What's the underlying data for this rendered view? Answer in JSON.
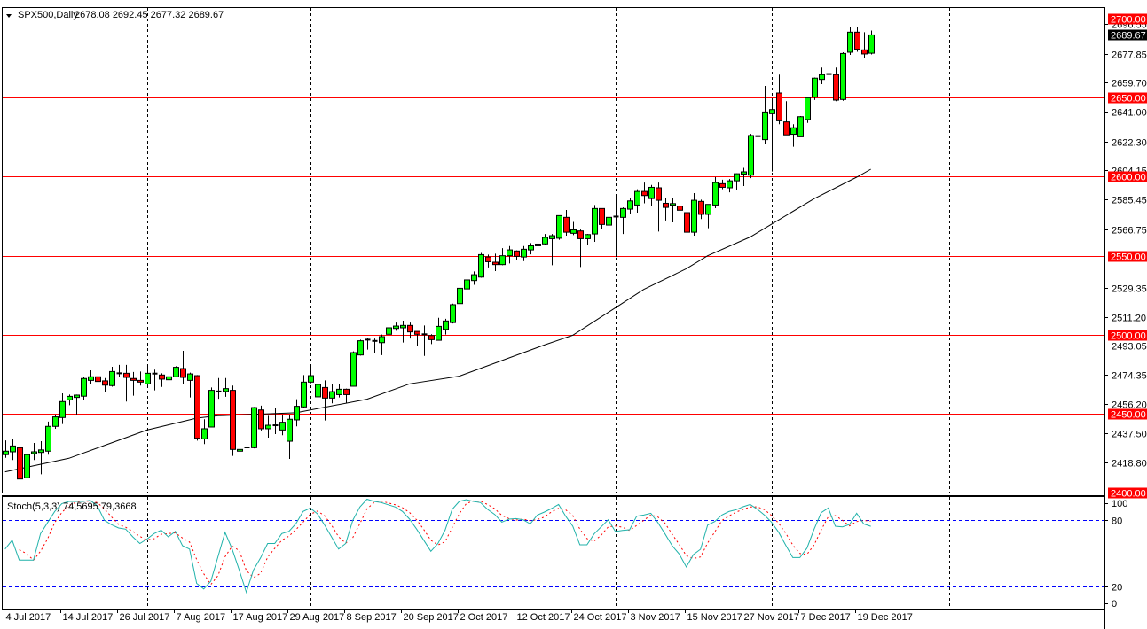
{
  "header": {
    "symbol_label": "SPX500,Daily",
    "ohlc_label": "2678.08 2692.45 2677.32 2689.67",
    "menu_icon": "triangle-down-icon"
  },
  "colors": {
    "background": "#FFFFFF",
    "bull_candle": "#00FF00",
    "bear_candle": "#FF0000",
    "candle_outline": "#000000",
    "level_line": "#FF0000",
    "moving_average": "#000000",
    "stoch_main": "#20B2AA",
    "stoch_signal": "#FF0000",
    "stoch_levels": "#0000FF",
    "current_price_bg": "#000000"
  },
  "chart_data": [
    {
      "type": "candlestick",
      "title": "SPX500,Daily",
      "ylim": [
        2400,
        2700
      ],
      "grid": "vertical dashed lines at month starts",
      "current_price": "2689.67",
      "y_tick_labels": [
        "2696.55",
        "2677.85",
        "2659.70",
        "2641.00",
        "2622.30",
        "2604.15",
        "2585.45",
        "2566.75",
        "2529.35",
        "2511.20",
        "2493.05",
        "2474.35",
        "2456.20",
        "2437.50",
        "2418.80"
      ],
      "level_lines": [
        "2700.00",
        "2650.00",
        "2600.00",
        "2550.00",
        "2500.00",
        "2450.00",
        "2400.00"
      ],
      "x_tick_labels": [
        {
          "label": "4 Jul 2017",
          "bar": 0
        },
        {
          "label": "14 Jul 2017",
          "bar": 8
        },
        {
          "label": "26 Jul 2017",
          "bar": 16
        },
        {
          "label": "7 Aug 2017",
          "bar": 24
        },
        {
          "label": "17 Aug 2017",
          "bar": 32
        },
        {
          "label": "29 Aug 2017",
          "bar": 40
        },
        {
          "label": "8 Sep 2017",
          "bar": 48
        },
        {
          "label": "20 Sep 2017",
          "bar": 56
        },
        {
          "label": "2 Oct 2017",
          "bar": 64
        },
        {
          "label": "12 Oct 2017",
          "bar": 72
        },
        {
          "label": "24 Oct 2017",
          "bar": 80
        },
        {
          "label": "3 Nov 2017",
          "bar": 88
        },
        {
          "label": "15 Nov 2017",
          "bar": 96
        },
        {
          "label": "27 Nov 2017",
          "bar": 104
        },
        {
          "label": "7 Dec 2017",
          "bar": 112
        },
        {
          "label": "19 Dec 2017",
          "bar": 120
        }
      ],
      "month_start_bars": [
        20,
        43,
        64,
        86,
        108,
        133
      ],
      "ohlc": [
        [
          2424.0,
          2433.0,
          2422.0,
          2426.2
        ],
        [
          2425.8,
          2433.7,
          2420.6,
          2429.5
        ],
        [
          2428.4,
          2430.7,
          2405.2,
          2408.6
        ],
        [
          2409.4,
          2426.0,
          2408.6,
          2424.0
        ],
        [
          2424.7,
          2431.4,
          2420.6,
          2425.8
        ],
        [
          2425.4,
          2432.5,
          2411.6,
          2427.0
        ],
        [
          2426.2,
          2444.9,
          2424.0,
          2441.9
        ],
        [
          2441.9,
          2449.4,
          2440.4,
          2447.9
        ],
        [
          2447.5,
          2462.8,
          2443.4,
          2457.6
        ],
        [
          2458.7,
          2462.0,
          2455.3,
          2460.9
        ],
        [
          2460.2,
          2462.0,
          2449.4,
          2461.7
        ],
        [
          2461.0,
          2472.9,
          2458.7,
          2472.2
        ],
        [
          2471.0,
          2477.4,
          2468.8,
          2473.3
        ],
        [
          2473.3,
          2477.4,
          2463.9,
          2470.3
        ],
        [
          2470.7,
          2472.5,
          2463.9,
          2468.0
        ],
        [
          2467.7,
          2479.6,
          2467.0,
          2476.6
        ],
        [
          2475.5,
          2480.8,
          2472.9,
          2475.5
        ],
        [
          2475.5,
          2480.8,
          2457.6,
          2472.9
        ],
        [
          2472.2,
          2476.3,
          2461.3,
          2471.0
        ],
        [
          2471.0,
          2476.6,
          2467.7,
          2469.9
        ],
        [
          2468.8,
          2480.8,
          2466.5,
          2475.5
        ],
        [
          2475.3,
          2477.8,
          2464.7,
          2475.3
        ],
        [
          2474.4,
          2475.5,
          2466.9,
          2471.8
        ],
        [
          2471.4,
          2477.8,
          2468.8,
          2473.3
        ],
        [
          2473.3,
          2480.0,
          2472.9,
          2479.3
        ],
        [
          2478.5,
          2489.7,
          2468.8,
          2472.9
        ],
        [
          2471.0,
          2475.9,
          2460.2,
          2475.1
        ],
        [
          2474.0,
          2474.4,
          2432.9,
          2434.4
        ],
        [
          2434.0,
          2446.4,
          2430.7,
          2440.4
        ],
        [
          2441.5,
          2466.5,
          2441.5,
          2464.7
        ],
        [
          2464.0,
          2472.5,
          2459.4,
          2464.0
        ],
        [
          2464.0,
          2472.5,
          2460.6,
          2465.8
        ],
        [
          2464.7,
          2467.7,
          2423.2,
          2427.3
        ],
        [
          2426.2,
          2439.3,
          2419.5,
          2427.3
        ],
        [
          2428.6,
          2431.0,
          2416.1,
          2428.6
        ],
        [
          2428.4,
          2454.2,
          2428.0,
          2453.8
        ],
        [
          2452.3,
          2455.0,
          2439.3,
          2440.4
        ],
        [
          2440.4,
          2448.6,
          2434.8,
          2442.6
        ],
        [
          2442.6,
          2453.8,
          2437.0,
          2442.6
        ],
        [
          2439.6,
          2449.4,
          2436.3,
          2444.5
        ],
        [
          2432.5,
          2449.4,
          2421.3,
          2446.4
        ],
        [
          2446.0,
          2459.1,
          2441.9,
          2454.6
        ],
        [
          2454.2,
          2474.4,
          2453.8,
          2469.9
        ],
        [
          2469.9,
          2480.8,
          2469.2,
          2474.0
        ],
        [
          2460.6,
          2468.8,
          2459.8,
          2468.4
        ],
        [
          2466.5,
          2471.0,
          2445.6,
          2459.8
        ],
        [
          2459.8,
          2468.8,
          2456.5,
          2463.9
        ],
        [
          2462.0,
          2468.4,
          2460.2,
          2465.4
        ],
        [
          2465.4,
          2465.8,
          2456.5,
          2462.0
        ],
        [
          2467.3,
          2489.4,
          2467.0,
          2488.6
        ],
        [
          2487.1,
          2496.8,
          2486.7,
          2496.1
        ],
        [
          2496.8,
          2497.9,
          2490.5,
          2496.8
        ],
        [
          2496.0,
          2497.5,
          2488.6,
          2496.0
        ],
        [
          2494.9,
          2500.0,
          2487.0,
          2498.7
        ],
        [
          2500.2,
          2507.1,
          2499.0,
          2504.3
        ],
        [
          2503.9,
          2507.6,
          2502.4,
          2505.4
        ],
        [
          2504.3,
          2508.8,
          2495.0,
          2505.8
        ],
        [
          2505.8,
          2507.6,
          2497.5,
          2501.7
        ],
        [
          2502.0,
          2502.0,
          2493.1,
          2500.2
        ],
        [
          2500.2,
          2505.8,
          2486.5,
          2500.2
        ],
        [
          2499.4,
          2500.2,
          2494.0,
          2496.8
        ],
        [
          2496.4,
          2510.6,
          2496.4,
          2505.2
        ],
        [
          2503.3,
          2510.0,
          2500.0,
          2508.6
        ],
        [
          2507.6,
          2519.6,
          2507.0,
          2518.9
        ],
        [
          2519.6,
          2529.9,
          2518.0,
          2529.3
        ],
        [
          2528.9,
          2535.5,
          2526.5,
          2534.6
        ],
        [
          2534.2,
          2540.0,
          2531.5,
          2537.9
        ],
        [
          2536.4,
          2551.7,
          2536.0,
          2550.6
        ],
        [
          2549.1,
          2550.6,
          2542.5,
          2546.1
        ],
        [
          2545.8,
          2551.2,
          2540.2,
          2544.3
        ],
        [
          2544.3,
          2554.7,
          2543.9,
          2549.9
        ],
        [
          2549.9,
          2556.0,
          2545.0,
          2553.6
        ],
        [
          2552.9,
          2553.3,
          2547.0,
          2549.5
        ],
        [
          2549.1,
          2556.0,
          2546.5,
          2554.0
        ],
        [
          2553.6,
          2557.9,
          2550.8,
          2556.2
        ],
        [
          2556.2,
          2559.6,
          2553.0,
          2557.3
        ],
        [
          2557.4,
          2563.7,
          2556.6,
          2561.5
        ],
        [
          2560.7,
          2563.7,
          2543.9,
          2562.6
        ],
        [
          2561.0,
          2575.3,
          2560.0,
          2575.3
        ],
        [
          2574.2,
          2578.9,
          2562.6,
          2564.8
        ],
        [
          2564.1,
          2571.3,
          2563.0,
          2566.3
        ],
        [
          2565.6,
          2566.5,
          2542.8,
          2560.7
        ],
        [
          2560.7,
          2563.7,
          2556.6,
          2563.3
        ],
        [
          2563.7,
          2582.0,
          2558.7,
          2579.8
        ],
        [
          2579.8,
          2579.8,
          2566.6,
          2569.7
        ],
        [
          2569.3,
          2575.0,
          2563.7,
          2574.2
        ],
        [
          2574.7,
          2588.0,
          2549.1,
          2574.7
        ],
        [
          2574.2,
          2580.5,
          2563.7,
          2579.8
        ],
        [
          2579.4,
          2586.5,
          2576.5,
          2584.6
        ],
        [
          2582.0,
          2592.0,
          2577.2,
          2590.6
        ],
        [
          2590.6,
          2596.2,
          2583.1,
          2588.0
        ],
        [
          2586.1,
          2594.7,
          2581.6,
          2593.2
        ],
        [
          2592.9,
          2596.2,
          2565.2,
          2585.0
        ],
        [
          2583.1,
          2586.5,
          2572.2,
          2580.5
        ],
        [
          2581.9,
          2586.5,
          2571.0,
          2582.9
        ],
        [
          2581.3,
          2583.1,
          2564.8,
          2578.7
        ],
        [
          2577.2,
          2577.2,
          2556.0,
          2564.8
        ],
        [
          2564.8,
          2589.5,
          2562.6,
          2585.0
        ],
        [
          2584.3,
          2585.4,
          2573.1,
          2576.1
        ],
        [
          2576.1,
          2582.4,
          2567.3,
          2582.4
        ],
        [
          2582.0,
          2599.7,
          2580.0,
          2596.2
        ],
        [
          2595.5,
          2598.0,
          2592.0,
          2593.2
        ],
        [
          2592.9,
          2598.4,
          2590.0,
          2597.3
        ],
        [
          2597.3,
          2602.0,
          2591.7,
          2601.8
        ],
        [
          2601.6,
          2605.5,
          2594.0,
          2603.0
        ],
        [
          2600.9,
          2627.0,
          2599.0,
          2626.0
        ],
        [
          2625.6,
          2633.8,
          2619.6,
          2625.6
        ],
        [
          2623.4,
          2657.4,
          2620.7,
          2640.9
        ],
        [
          2639.8,
          2648.7,
          2603.2,
          2642.4
        ],
        [
          2652.9,
          2664.5,
          2633.1,
          2635.3
        ],
        [
          2634.6,
          2647.7,
          2626.4,
          2626.4
        ],
        [
          2626.8,
          2633.1,
          2618.9,
          2630.9
        ],
        [
          2625.2,
          2638.3,
          2625.2,
          2637.9
        ],
        [
          2636.1,
          2650.3,
          2634.0,
          2649.9
        ],
        [
          2650.3,
          2662.7,
          2648.5,
          2662.3
        ],
        [
          2661.5,
          2669.0,
          2658.5,
          2664.5
        ],
        [
          2664.9,
          2671.2,
          2655.2,
          2664.9
        ],
        [
          2664.5,
          2669.0,
          2647.7,
          2648.4
        ],
        [
          2648.8,
          2678.7,
          2648.0,
          2677.9
        ],
        [
          2678.7,
          2694.4,
          2677.0,
          2691.4
        ],
        [
          2691.4,
          2694.4,
          2679.0,
          2680.6
        ],
        [
          2680.2,
          2691.4,
          2675.0,
          2677.6
        ],
        [
          2678.08,
          2692.45,
          2677.32,
          2689.67
        ]
      ],
      "moving_average": [
        [
          0,
          2413.1
        ],
        [
          9,
          2421.7
        ],
        [
          20,
          2439.6
        ],
        [
          27,
          2447.1
        ],
        [
          30,
          2448.6
        ],
        [
          41,
          2450.5
        ],
        [
          51,
          2459.1
        ],
        [
          57,
          2468.8
        ],
        [
          64,
          2473.7
        ],
        [
          76,
          2493.4
        ],
        [
          80,
          2499.6
        ],
        [
          86,
          2517.0
        ],
        [
          90,
          2528.6
        ],
        [
          96,
          2541.7
        ],
        [
          99,
          2549.9
        ],
        [
          105,
          2561.8
        ],
        [
          114,
          2586.0
        ],
        [
          120,
          2599.6
        ],
        [
          122,
          2604.7
        ]
      ]
    },
    {
      "type": "line",
      "title": "Stoch(5,3,3)",
      "label": "Stoch(5,3,3) 74,5695 79,3668",
      "ylim": [
        0,
        100
      ],
      "y_tick_labels": [
        "100",
        "80",
        "20",
        "0"
      ],
      "levels": [
        80,
        20
      ],
      "main": [
        54,
        62,
        44,
        44,
        44,
        68,
        78,
        88,
        95,
        97,
        97,
        97,
        98,
        93,
        80,
        76,
        73,
        72,
        65,
        59,
        63,
        68,
        71,
        65,
        70,
        57,
        54,
        23,
        18,
        25,
        47,
        69,
        54,
        35,
        15,
        35,
        46,
        59,
        59,
        68,
        70,
        77,
        88,
        91,
        86,
        76,
        65,
        54,
        59,
        80,
        92,
        99,
        97,
        96,
        94,
        92,
        88,
        81,
        72,
        62,
        52,
        59,
        71,
        89.8,
        97,
        98.6,
        97,
        96,
        89.8,
        85.3,
        78.3,
        81,
        81.5,
        80.5,
        76.7,
        84.7,
        87.4,
        90.6,
        94.3,
        83.7,
        74.6,
        57.8,
        57.8,
        67.7,
        74.1,
        80.5,
        69.8,
        70.9,
        71.4,
        83.7,
        84.7,
        86.3,
        77.8,
        67.7,
        57,
        49.5,
        37.8,
        49,
        53.8,
        75.7,
        78.9,
        84.7,
        87.9,
        89.5,
        92.2,
        94.3,
        90,
        84.7,
        78.3,
        69.3,
        57.5,
        46.3,
        46.3,
        54.9,
        71.9,
        86.9,
        91.1,
        74.6,
        74.1,
        76.2,
        86.3,
        76.7,
        74.5695
      ]
    }
  ]
}
